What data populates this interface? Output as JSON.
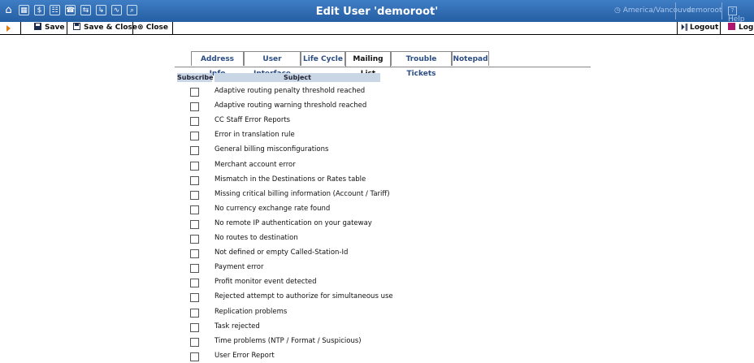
{
  "window": {
    "title": "Edit User 'demoroot'",
    "timezone": "America/Vancouver",
    "username": "demoroot",
    "help_label": "Help",
    "help_icon_glyph": "?"
  },
  "nav_icons": [
    {
      "name": "home-icon",
      "glyph": "⌂"
    },
    {
      "name": "grid-icon",
      "glyph": "▦"
    },
    {
      "name": "dollar-icon",
      "glyph": "$"
    },
    {
      "name": "users-icon",
      "glyph": "☷"
    },
    {
      "name": "phone-icon",
      "glyph": "☎"
    },
    {
      "name": "network-icon",
      "glyph": "⇆"
    },
    {
      "name": "routing-icon",
      "glyph": "↳"
    },
    {
      "name": "chart-icon",
      "glyph": "∿"
    },
    {
      "name": "search-icon",
      "glyph": "⌕"
    }
  ],
  "toolbar": {
    "save_label": "Save",
    "save_close_label": "Save & Close",
    "close_label": "Close",
    "close_icon_glyph": "⊗",
    "logout_icon_glyph": "⏵‖",
    "logout_label": "Logout",
    "log_label": "Log"
  },
  "tabs": [
    {
      "label": "Address Info"
    },
    {
      "label": "User Interface"
    },
    {
      "label": "Life Cycle"
    },
    {
      "label": "Mailing List",
      "active": true
    },
    {
      "label": "Trouble Tickets"
    },
    {
      "label": "Notepad"
    }
  ],
  "table": {
    "col_subscribe": "Subscribe",
    "col_subject": "Subject",
    "rows": [
      {
        "subject": "Adaptive routing penalty threshold reached",
        "checked": false
      },
      {
        "subject": "Adaptive routing warning threshold reached",
        "checked": false
      },
      {
        "subject": "CC Staff Error Reports",
        "checked": false
      },
      {
        "subject": "Error in translation rule",
        "checked": false
      },
      {
        "subject": "General billing misconfigurations",
        "checked": false
      },
      {
        "subject": "Merchant account error",
        "checked": false
      },
      {
        "subject": "Mismatch in the Destinations or Rates table",
        "checked": false
      },
      {
        "subject": "Missing critical billing information (Account / Tariff)",
        "checked": false
      },
      {
        "subject": "No currency exchange rate found",
        "checked": false
      },
      {
        "subject": "No remote IP authentication on your gateway",
        "checked": false
      },
      {
        "subject": "No routes to destination",
        "checked": false
      },
      {
        "subject": "Not defined or empty Called-Station-Id",
        "checked": false
      },
      {
        "subject": "Payment error",
        "checked": false
      },
      {
        "subject": "Profit monitor event detected",
        "checked": false
      },
      {
        "subject": "Rejected attempt to authorize for simultaneous use",
        "checked": false
      },
      {
        "subject": "Replication problems",
        "checked": false
      },
      {
        "subject": "Task rejected",
        "checked": false
      },
      {
        "subject": "Time problems (NTP / Format / Suspicious)",
        "checked": false
      },
      {
        "subject": "User Error Report",
        "checked": false
      }
    ]
  }
}
